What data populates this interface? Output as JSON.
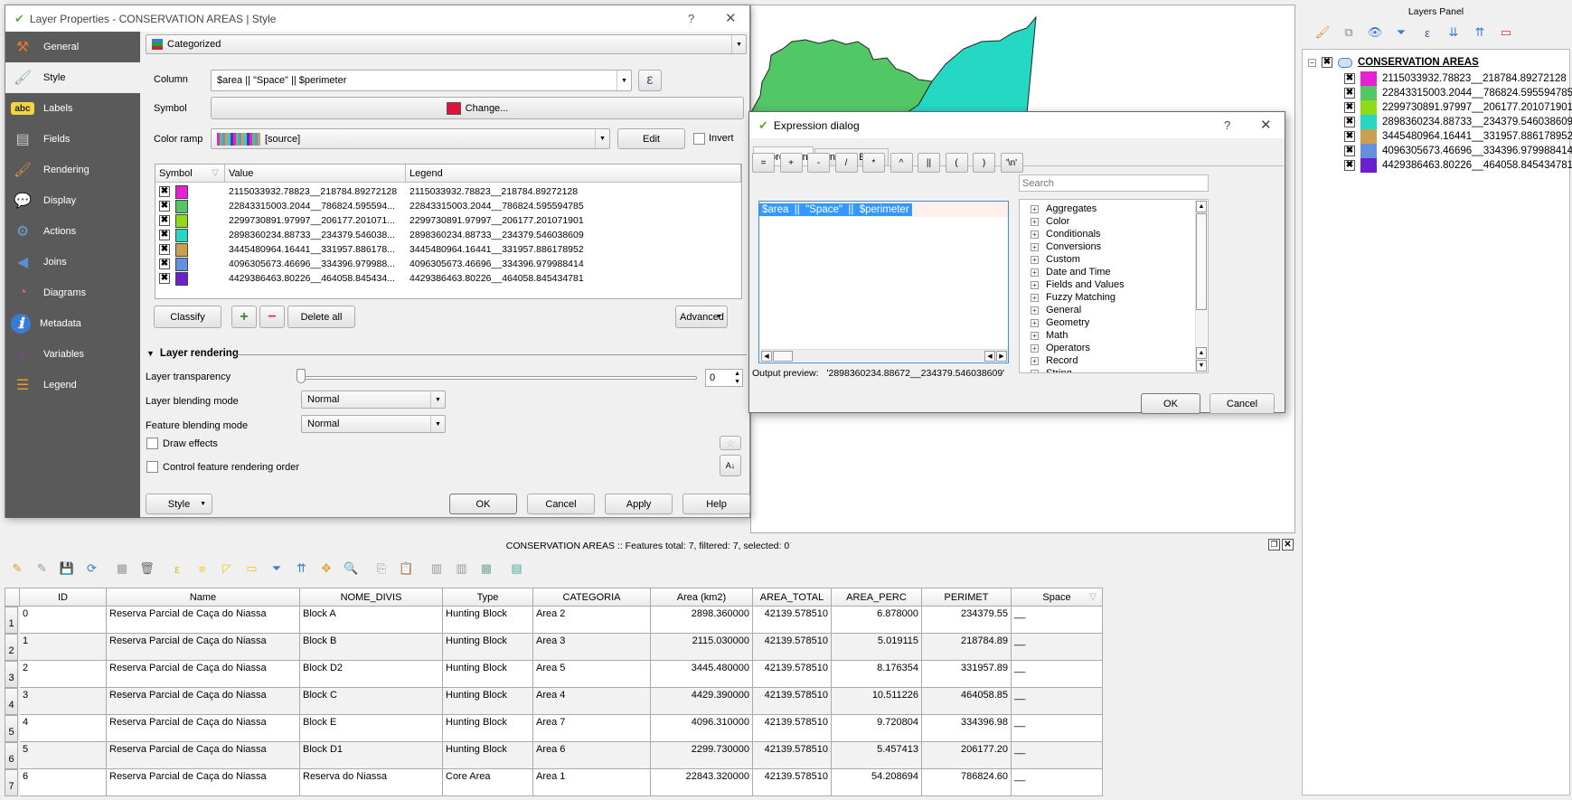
{
  "layer_properties": {
    "title": "Layer Properties - CONSERVATION AREAS | Style",
    "help_label": "?",
    "close_label": "✕",
    "sidebar": [
      {
        "label": "General",
        "icon": "tools-icon"
      },
      {
        "label": "Style",
        "icon": "paintbrush-icon"
      },
      {
        "label": "Labels",
        "icon": "labels-abc-icon"
      },
      {
        "label": "Fields",
        "icon": "fields-table-icon"
      },
      {
        "label": "Rendering",
        "icon": "rendering-brush-icon"
      },
      {
        "label": "Display",
        "icon": "speech-bubble-icon"
      },
      {
        "label": "Actions",
        "icon": "actions-gear-icon"
      },
      {
        "label": "Joins",
        "icon": "joins-arrow-icon"
      },
      {
        "label": "Diagrams",
        "icon": "diagrams-pie-icon"
      },
      {
        "label": "Metadata",
        "icon": "info-icon"
      },
      {
        "label": "Variables",
        "icon": "epsilon-icon"
      },
      {
        "label": "Legend",
        "icon": "legend-icon"
      }
    ],
    "active_item": "Style",
    "renderer_type": "Categorized",
    "column_label": "Column",
    "column_value": "$area  ||  \"Space\"  ||  $perimeter",
    "symbol_label": "Symbol",
    "symbol_button": "Change...",
    "symbol_color": "#dc143c",
    "color_ramp_label": "Color ramp",
    "color_ramp_value": "[source]",
    "edit_button": "Edit",
    "invert_label": "Invert",
    "table_headers": [
      "Symbol",
      "Value",
      "Legend"
    ],
    "categories": [
      {
        "color": "#e91fd4",
        "value": "2115033932.78823__218784.89272128",
        "legend": "2115033932.78823__218784.89272128"
      },
      {
        "color": "#52c766",
        "value": "22843315003.2044__786824.595594...",
        "legend": "22843315003.2044__786824.595594785"
      },
      {
        "color": "#8fdb18",
        "value": "2299730891.97997__206177.201071...",
        "legend": "2299730891.97997__206177.201071901"
      },
      {
        "color": "#24d8c4",
        "value": "2898360234.88733__234379.546038...",
        "legend": "2898360234.88733__234379.546038609"
      },
      {
        "color": "#c9a050",
        "value": "3445480964.16441__331957.886178...",
        "legend": "3445480964.16441__331957.886178952"
      },
      {
        "color": "#6490e0",
        "value": "4096305673.46696__334396.979988...",
        "legend": "4096305673.46696__334396.979988414"
      },
      {
        "color": "#6b1fd0",
        "value": "4429386463.80226__464058.845434...",
        "legend": "4429386463.80226__464058.845434781"
      }
    ],
    "classify_button": "Classify",
    "add_button": "+",
    "remove_button": "−",
    "delete_all_button": "Delete all",
    "advanced_button": "Advanced",
    "layer_rendering_title": "Layer rendering",
    "transparency_label": "Layer transparency",
    "transparency_value": "0",
    "layer_blending_label": "Layer blending mode",
    "layer_blending_value": "Normal",
    "feature_blending_label": "Feature blending mode",
    "feature_blending_value": "Normal",
    "draw_effects_label": "Draw effects",
    "control_order_label": "Control feature rendering order",
    "style_button": "Style",
    "ok_button": "OK",
    "cancel_button": "Cancel",
    "apply_button": "Apply",
    "help_button": "Help"
  },
  "expression_dialog": {
    "title": "Expression dialog",
    "help_label": "?",
    "close_label": "✕",
    "tabs": [
      "Expression",
      "Function Editor"
    ],
    "operators": [
      "=",
      "+",
      "-",
      "/",
      "*",
      "^",
      "||",
      "(",
      ")",
      "'\\n'"
    ],
    "expression": "$area  ||  \"Space\"  ||  $perimeter",
    "search_placeholder": "Search",
    "function_groups": [
      "Aggregates",
      "Color",
      "Conditionals",
      "Conversions",
      "Custom",
      "Date and Time",
      "Fields and Values",
      "Fuzzy Matching",
      "General",
      "Geometry",
      "Math",
      "Operators",
      "Record",
      "String"
    ],
    "output_preview_label": "Output preview:",
    "output_preview_value": "'2898360234.88672__234379.546038609'",
    "ok_button": "OK",
    "cancel_button": "Cancel"
  },
  "attribute_table": {
    "title": "CONSERVATION AREAS :: Features total: 7, filtered: 7, selected: 0",
    "toolbar_icons": [
      "toggle-editing-icon",
      "multi-edit-icon",
      "save-edits-icon",
      "reload-icon",
      "add-feature-icon",
      "delete-feature-icon",
      "select-by-expression-icon",
      "select-all-icon",
      "invert-selection-icon",
      "deselect-all-icon",
      "filter-icon",
      "move-selection-top-icon",
      "pan-to-selection-icon",
      "zoom-to-selection-icon",
      "copy-icon",
      "paste-icon",
      "new-field-icon",
      "delete-field-icon",
      "field-calculator-icon",
      "conditional-formatting-icon"
    ],
    "columns": [
      "ID",
      "Name",
      "NOME_DIVIS",
      "Type",
      "CATEGORIA",
      "Area (km2)",
      "AREA_TOTAL",
      "AREA_PERC",
      "PERIMET",
      "Space"
    ],
    "rows": [
      [
        "0",
        "Reserva Parcial de Caça do Niassa",
        "Block A",
        "Hunting Block",
        "Area 2",
        "2898.360000",
        "42139.578510",
        "6.878000",
        "234379.55",
        "__"
      ],
      [
        "1",
        "Reserva Parcial de Caça do Niassa",
        "Block B",
        "Hunting Block",
        "Area 3",
        "2115.030000",
        "42139.578510",
        "5.019115",
        "218784.89",
        "__"
      ],
      [
        "2",
        "Reserva Parcial de Caça do Niassa",
        "Block D2",
        "Hunting Block",
        "Area 5",
        "3445.480000",
        "42139.578510",
        "8.176354",
        "331957.89",
        "__"
      ],
      [
        "3",
        "Reserva Parcial de Caça do Niassa",
        "Block C",
        "Hunting Block",
        "Area 4",
        "4429.390000",
        "42139.578510",
        "10.511226",
        "464058.85",
        "__"
      ],
      [
        "4",
        "Reserva Parcial de Caça do Niassa",
        "Block E",
        "Hunting Block",
        "Area 7",
        "4096.310000",
        "42139.578510",
        "9.720804",
        "334396.98",
        "__"
      ],
      [
        "5",
        "Reserva Parcial de Caça do Niassa",
        "Block D1",
        "Hunting Block",
        "Area 6",
        "2299.730000",
        "42139.578510",
        "5.457413",
        "206177.20",
        "__"
      ],
      [
        "6",
        "Reserva Parcial de Caça do Niassa",
        "Reserva do Niassa",
        "Core Area",
        "Area 1",
        "22843.320000",
        "42139.578510",
        "54.208694",
        "786824.60",
        "__"
      ]
    ],
    "row_numbers": [
      "1",
      "2",
      "3",
      "4",
      "5",
      "6",
      "7"
    ]
  },
  "layers_panel": {
    "title": "Layers Panel",
    "toolbar_icons": [
      "style-manager-icon",
      "add-group-icon",
      "visibility-icon",
      "filter-legend-icon",
      "filter-expression-icon",
      "expand-all-icon",
      "collapse-all-icon",
      "remove-layer-icon"
    ],
    "layer_name": "CONSERVATION AREAS",
    "items": [
      {
        "color": "#e91fd4",
        "label": "2115033932.78823__218784.89272128"
      },
      {
        "color": "#52c766",
        "label": "22843315003.2044__786824.595594785"
      },
      {
        "color": "#8fdb18",
        "label": "2299730891.97997__206177.201071901"
      },
      {
        "color": "#24d8c4",
        "label": "2898360234.88733__234379.546038609"
      },
      {
        "color": "#c9a050",
        "label": "3445480964.16441__331957.886178952"
      },
      {
        "color": "#6490e0",
        "label": "4096305673.46696__334396.979988414"
      },
      {
        "color": "#6b1fd0",
        "label": "4429386463.80226__464058.845434781"
      }
    ]
  },
  "map": {
    "polygon_colors": [
      "#52c766",
      "#24d8c4"
    ]
  }
}
